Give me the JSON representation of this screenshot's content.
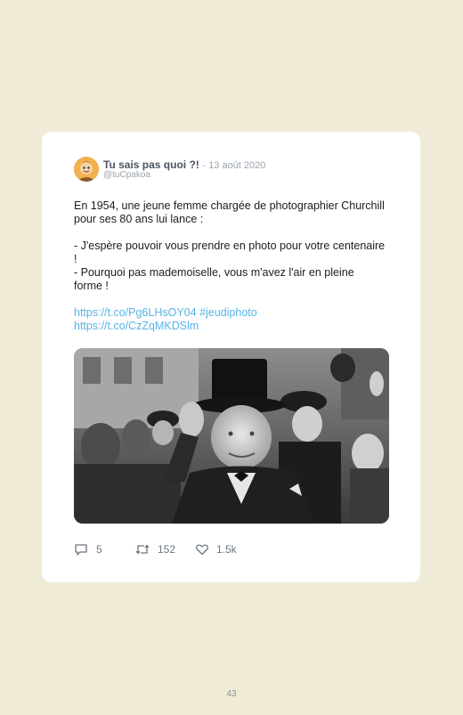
{
  "tweet": {
    "author": "Tu sais pas quoi ?!",
    "separator": "-",
    "date": "13 août 2020",
    "handle": "@tuCpakoa",
    "text": {
      "line1": "En 1954, une jeune femme chargée de photographier Churchill pour ses 80 ans lui lance :",
      "line2": "- J'espère pouvoir vous prendre en photo pour votre centenaire !",
      "line3": "- Pourquoi pas mademoiselle, vous m'avez l'air en pleine forme !",
      "link1": "https://t.co/Pg6LHsOY04",
      "hashtag": "#jeudiphoto",
      "link2": "https://t.co/CzZqMKDSlm"
    },
    "actions": {
      "replies": "5",
      "retweets": "152",
      "likes": "1.5k"
    }
  },
  "colors": {
    "background": "#efebd6",
    "card": "#ffffff",
    "link": "#56b4e6",
    "author": "#4a5560",
    "meta": "#9aa3ab"
  },
  "icons": {
    "reply": "comment-bubble-icon",
    "retweet": "retweet-icon",
    "like": "heart-icon"
  },
  "page": {
    "number": "43"
  }
}
